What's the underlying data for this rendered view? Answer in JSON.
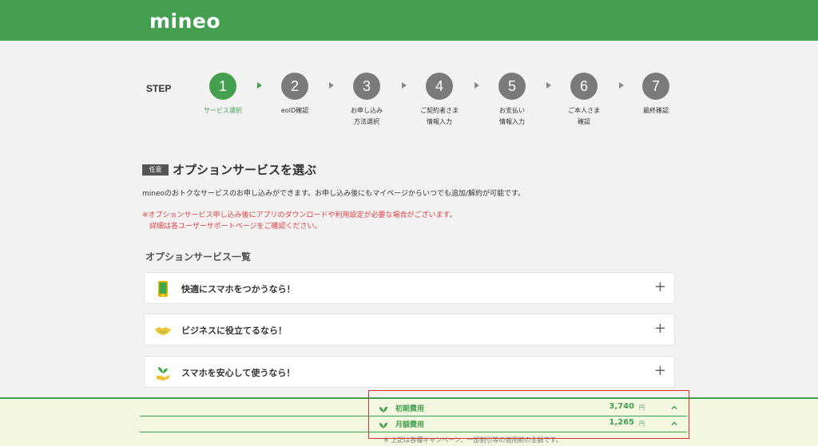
{
  "header": {
    "logo": "mineo"
  },
  "steps": {
    "label": "STEP",
    "items": [
      {
        "num": "1",
        "label": "サービス選択"
      },
      {
        "num": "2",
        "label": "eoID確認"
      },
      {
        "num": "3",
        "label": "お申し込み\n方法選択"
      },
      {
        "num": "4",
        "label": "ご契約者さま\n情報入力"
      },
      {
        "num": "5",
        "label": "お支払い\n情報入力"
      },
      {
        "num": "6",
        "label": "ご本人さま\n確認"
      },
      {
        "num": "7",
        "label": "最終確認"
      }
    ]
  },
  "section": {
    "badge": "任意",
    "title": "オプションサービスを選ぶ",
    "description": "mineoのおトクなサービスのお申し込みができます。お申し込み後にもマイページからいつでも追加/解約が可能です。",
    "warning_line1": "※オプションサービス申し込み後にアプリのダウンロードや利用設定が必要な場合がございます。",
    "warning_line2": "詳細は各ユーザーサポートページをご確認ください。",
    "list_title": "オプションサービス一覧"
  },
  "options": [
    {
      "title": "快適にスマホをつかうなら！",
      "icon": "smartphone-icon"
    },
    {
      "title": "ビジネスに役立てるなら！",
      "icon": "handshake-icon"
    },
    {
      "title": "スマホを安心して使うなら！",
      "icon": "plant-hand-icon"
    }
  ],
  "footer": {
    "initial_label": "初期費用",
    "initial_amount": "3,740",
    "monthly_label": "月額費用",
    "monthly_amount": "1,265",
    "yen": "円",
    "note": "※ 上記は各種キャンペーン、一部割引等の適用前の金額です。"
  },
  "colors": {
    "brand": "#44a050",
    "warning": "#e04040",
    "highlight_box": "#e03030"
  }
}
